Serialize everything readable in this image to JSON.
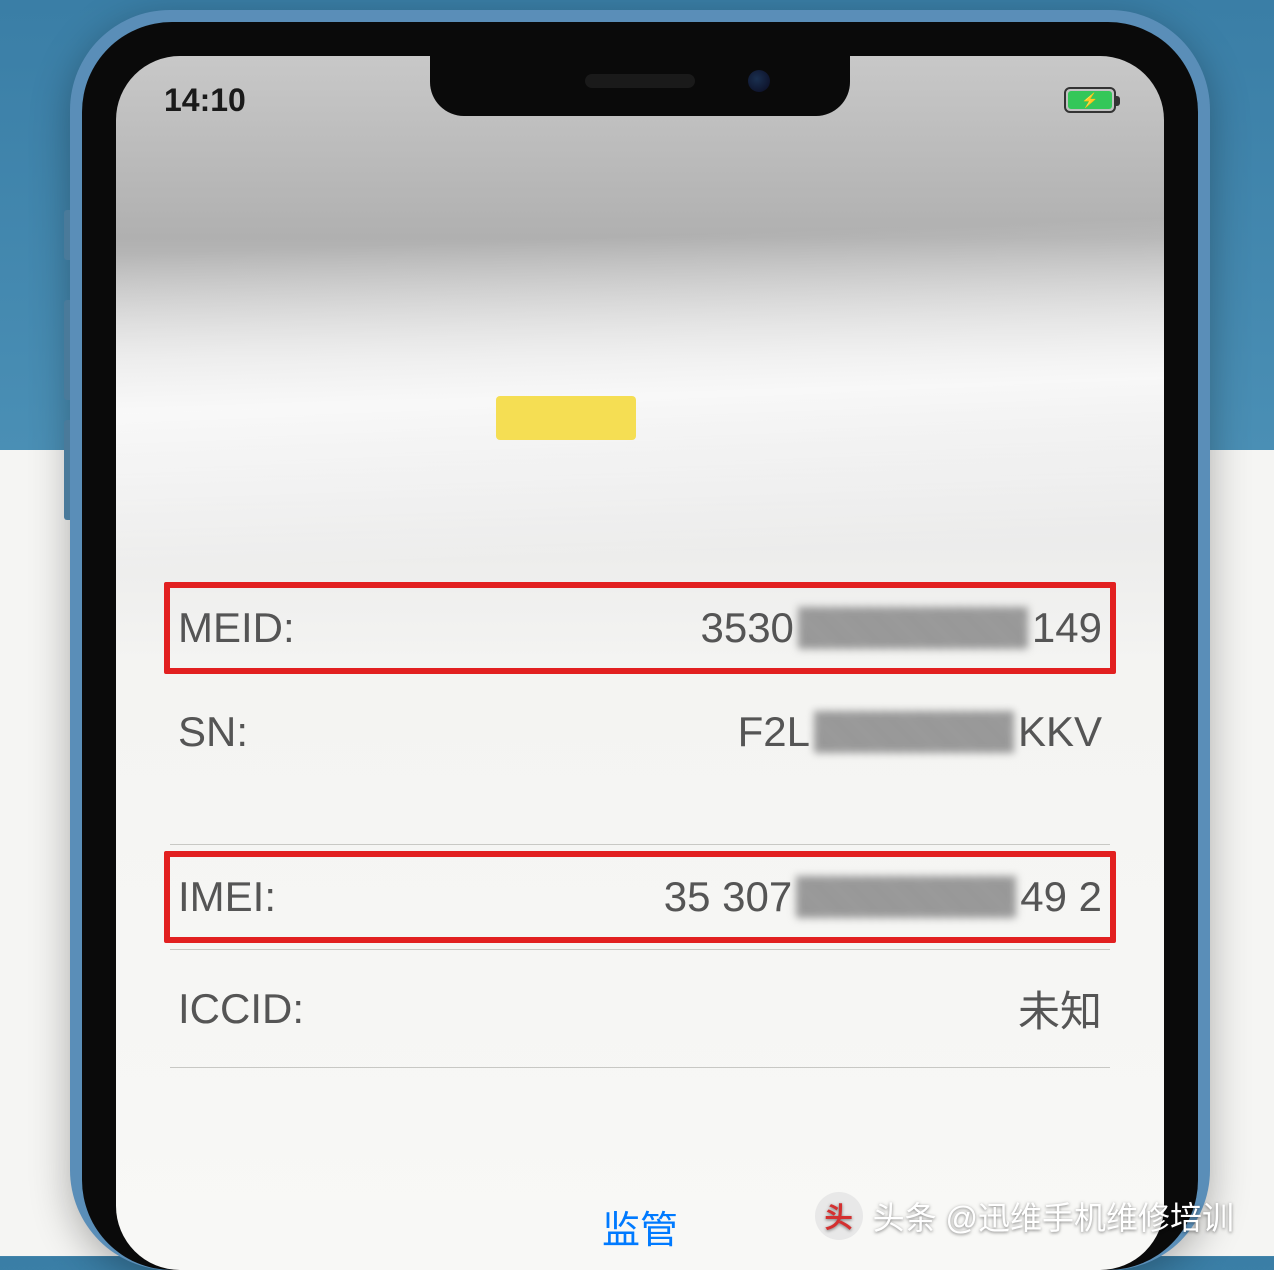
{
  "status": {
    "time": "14:10",
    "carrier": "",
    "bolt": "⚡"
  },
  "info": {
    "meid_label": "MEID:",
    "meid_prefix": "3530",
    "meid_suffix": "149",
    "sn_label": "SN:",
    "sn_prefix": "F2L",
    "sn_suffix": "KKV",
    "imei_label": "IMEI:",
    "imei_prefix": "35 307",
    "imei_suffix": "49 2",
    "iccid_label": "ICCID:",
    "iccid_value": "未知"
  },
  "bottom_tab": "监管",
  "watermark": "头条 @迅维手机维修培训"
}
